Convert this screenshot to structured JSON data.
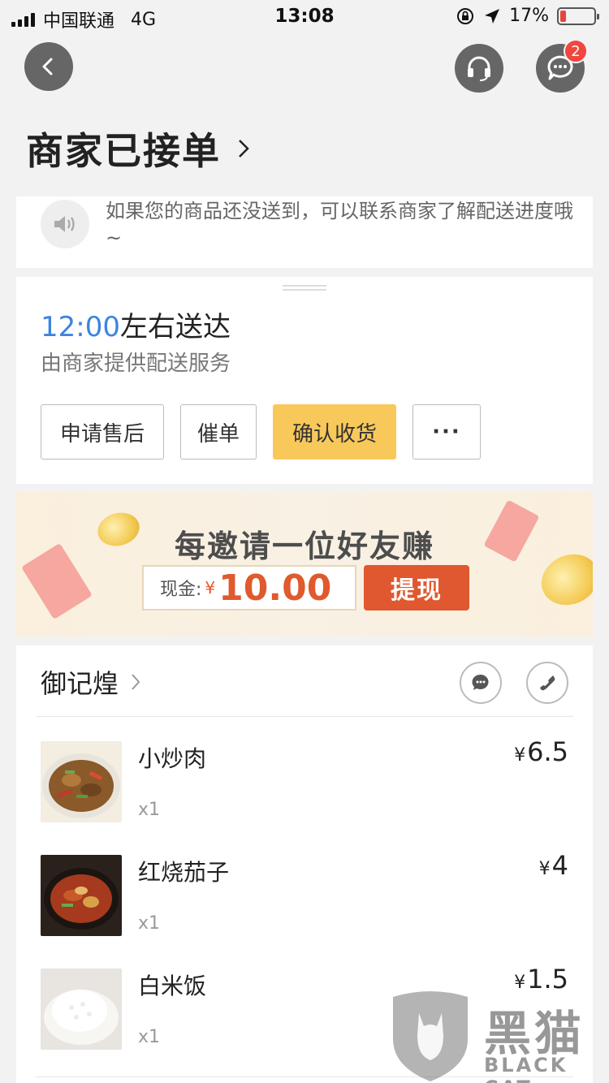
{
  "status_bar": {
    "carrier": "中国联通",
    "network": "4G",
    "time": "13:08",
    "battery_percent": "17%",
    "battery_level": 0.17
  },
  "header": {
    "back_icon": "chevron-left-icon",
    "service_icon": "headset-icon",
    "message_icon": "chat-bubble-icon",
    "message_badge": "2",
    "order_status": "商家已接单"
  },
  "notice": {
    "icon": "speaker-icon",
    "text": "如果您的商品还没送到，可以联系商家了解配送进度哦~"
  },
  "delivery": {
    "eta_time": "12:00",
    "eta_suffix": "左右送达",
    "provider": "由商家提供配送服务",
    "actions": [
      "申请售后",
      "催单",
      "确认收货",
      "···"
    ]
  },
  "banner": {
    "title": "每邀请一位好友赚",
    "cash_label": "现金:",
    "currency": "¥",
    "amount": "10.00",
    "button": "提现"
  },
  "shop": {
    "name": "御记煌",
    "items": [
      {
        "name": "小炒肉",
        "qty": "x1",
        "currency": "¥",
        "price": "6.5"
      },
      {
        "name": "红烧茄子",
        "qty": "x1",
        "currency": "¥",
        "price": "4"
      },
      {
        "name": "白米饭",
        "qty": "x1",
        "currency": "¥",
        "price": "1.5"
      }
    ]
  },
  "watermark": {
    "text": "黑猫",
    "sub": "BLACK CAT"
  },
  "colors": {
    "accent_blue": "#3c84e0",
    "confirm_yellow": "#f8c85a",
    "cash_red": "#e05a2d",
    "badge_red": "#f0463e"
  }
}
